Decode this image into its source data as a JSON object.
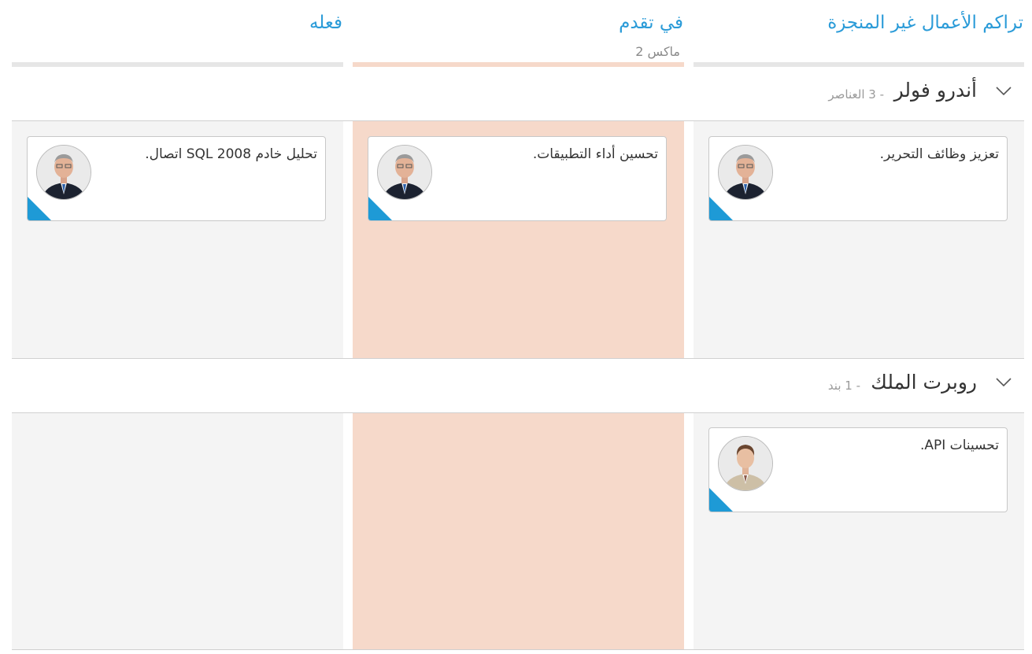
{
  "columns": [
    {
      "title": "تراكم الأعمال غير المنجزة"
    },
    {
      "title": "في تقدم",
      "max_label": "ماكس 2"
    },
    {
      "title": "فعله"
    }
  ],
  "swimlanes": [
    {
      "name": "أندرو فولر",
      "count": "- 3 العناصر",
      "cards": [
        {
          "text": "تعزيز وظائف التحرير."
        },
        {
          "text": "تحسين أداء التطبيقات."
        },
        {
          "text": "تحليل خادم SQL 2008 اتصال."
        }
      ]
    },
    {
      "name": "روبرت الملك",
      "count": "- 1 بند",
      "cards": [
        {
          "text": "تحسينات API."
        }
      ]
    }
  ],
  "colors": {
    "accent": "#2a9bd8",
    "in_progress_bg": "#f6d9ca",
    "cell_bg": "#f4f4f4",
    "card_tag": "#1e9ad6"
  }
}
